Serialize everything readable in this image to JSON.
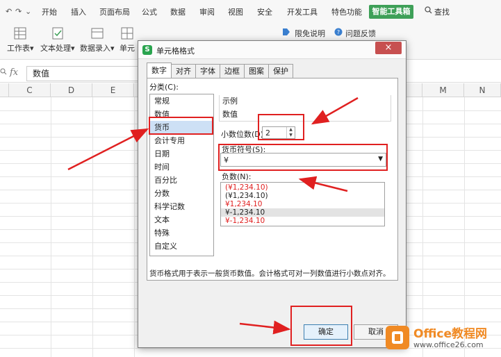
{
  "menubar": {
    "items": [
      "开始",
      "插入",
      "页面布局",
      "公式",
      "数据",
      "审阅",
      "视图",
      "安全",
      "开发工具",
      "特色功能"
    ],
    "active_tab": "智能工具箱",
    "search_label": "查找"
  },
  "toolbar": {
    "tools": [
      "工作表",
      "文本处理",
      "数据录入",
      "单元"
    ],
    "limit_label": "限免说明",
    "feedback_label": "问题反馈"
  },
  "formula_bar": {
    "fx": "fx",
    "value": "数值"
  },
  "grid": {
    "columns": [
      "C",
      "D",
      "E",
      "M",
      "N"
    ]
  },
  "dialog": {
    "title": "单元格格式",
    "close": "×",
    "tabs": [
      "数字",
      "对齐",
      "字体",
      "边框",
      "图案",
      "保护"
    ],
    "category_label": "分类(C):",
    "categories": [
      "常规",
      "数值",
      "货币",
      "会计专用",
      "日期",
      "时间",
      "百分比",
      "分数",
      "科学记数",
      "文本",
      "特殊",
      "自定义"
    ],
    "selected_category": "货币",
    "sample_label": "示例",
    "sample_value": "数值",
    "decimal_label": "小数位数(D):",
    "decimal_value": "2",
    "symbol_label": "货币符号(S):",
    "symbol_value": "¥",
    "negative_label": "负数(N):",
    "negatives": [
      "(¥1,234.10)",
      "(¥1,234.10)",
      "¥1,234.10",
      "¥-1,234.10",
      "¥-1,234.10"
    ],
    "description": "货币格式用于表示一般货币数值。会计格式可对一列数值进行小数点对齐。",
    "ok": "确定",
    "cancel": "取消"
  },
  "watermark": {
    "name": "Office教程网",
    "url": "www.office26.com"
  },
  "colors": {
    "annotation": "#e02020",
    "accent": "#3ea058",
    "negative_red": "#e02020"
  }
}
